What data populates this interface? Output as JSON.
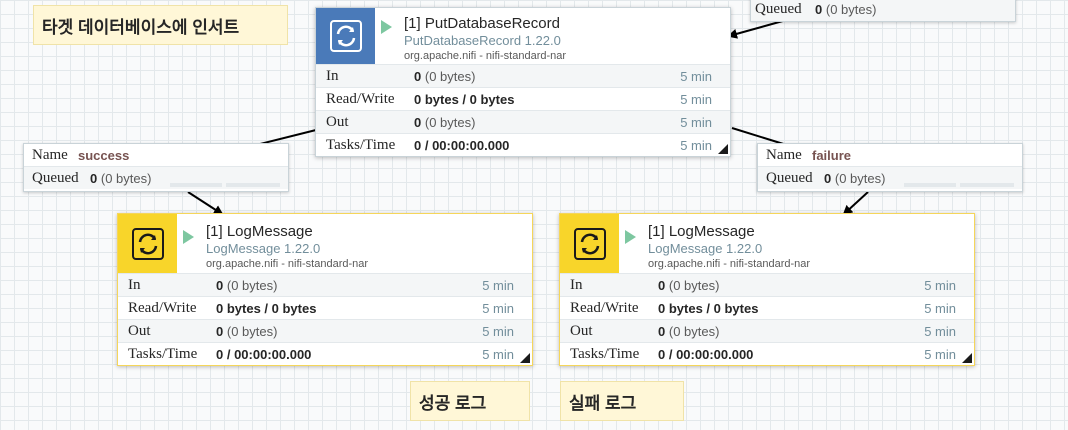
{
  "labels": {
    "target_db": "타겟 데이터베이스에 인서트",
    "success_log": "성공 로그",
    "failure_log": "실패 로그"
  },
  "processors": {
    "put_db": {
      "name": "[1] PutDatabaseRecord",
      "type": "PutDatabaseRecord 1.22.0",
      "bundle": "org.apache.nifi - nifi-standard-nar",
      "in_count": "0",
      "in_bytes": "(0 bytes)",
      "in_time": "5 min",
      "rw_value": "0 bytes / 0 bytes",
      "rw_time": "5 min",
      "out_count": "0",
      "out_bytes": "(0 bytes)",
      "out_time": "5 min",
      "tasks_value": "0 / 00:00:00.000",
      "tasks_time": "5 min",
      "color": "#4a7ab9"
    },
    "log_success": {
      "name": "[1] LogMessage",
      "type": "LogMessage 1.22.0",
      "bundle": "org.apache.nifi - nifi-standard-nar",
      "in_count": "0",
      "in_bytes": "(0 bytes)",
      "in_time": "5 min",
      "rw_value": "0 bytes / 0 bytes",
      "rw_time": "5 min",
      "out_count": "0",
      "out_bytes": "(0 bytes)",
      "out_time": "5 min",
      "tasks_value": "0 / 00:00:00.000",
      "tasks_time": "5 min",
      "color": "#f8d52a"
    },
    "log_failure": {
      "name": "[1] LogMessage",
      "type": "LogMessage 1.22.0",
      "bundle": "org.apache.nifi - nifi-standard-nar",
      "in_count": "0",
      "in_bytes": "(0 bytes)",
      "in_time": "5 min",
      "rw_value": "0 bytes / 0 bytes",
      "rw_time": "5 min",
      "out_count": "0",
      "out_bytes": "(0 bytes)",
      "out_time": "5 min",
      "tasks_value": "0 / 00:00:00.000",
      "tasks_time": "5 min",
      "color": "#f8d52a"
    }
  },
  "stat_labels": {
    "in": "In",
    "read_write": "Read/Write",
    "out": "Out",
    "tasks_time": "Tasks/Time"
  },
  "connections": {
    "top": {
      "queued_label": "Queued",
      "queued_count": "0",
      "queued_bytes": "(0 bytes)"
    },
    "success": {
      "name_label": "Name",
      "name": "success",
      "queued_label": "Queued",
      "queued_count": "0",
      "queued_bytes": "(0 bytes)"
    },
    "failure": {
      "name_label": "Name",
      "name": "failure",
      "queued_label": "Queued",
      "queued_count": "0",
      "queued_bytes": "(0 bytes)"
    }
  },
  "icons": {
    "processor_icon": "processor-icon",
    "run_icon": "run-status-icon"
  }
}
